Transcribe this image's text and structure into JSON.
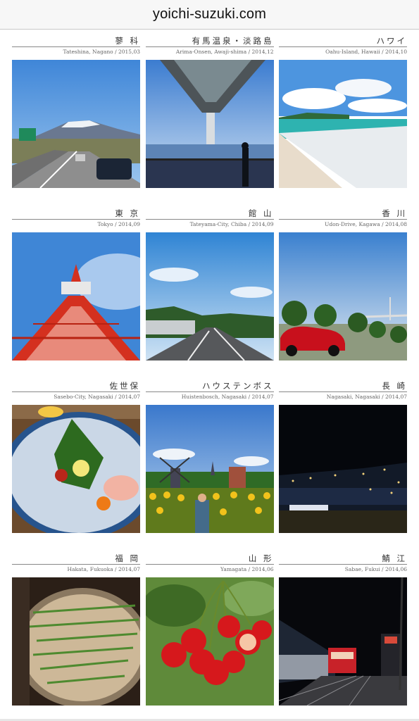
{
  "site": {
    "title": "yoichi-suzuki.com"
  },
  "posts": [
    {
      "title": "蓼 科",
      "subtitle": "Tateshina, Nagano / 2015,03",
      "photo": "highway-mountain-photo"
    },
    {
      "title": "有馬温泉・淡路島",
      "subtitle": "Arima-Onsen, Awaji-shima / 2014,12",
      "photo": "bridge-underside-photo"
    },
    {
      "title": "ハワイ",
      "subtitle": "Oahu-Island, Hawaii / 2014,10",
      "photo": "beach-photo"
    },
    {
      "title": "東 京",
      "subtitle": "Tokyo / 2014,09",
      "photo": "tokyo-tower-photo"
    },
    {
      "title": "館 山",
      "subtitle": "Tateyama-City, Chiba / 2014,09",
      "photo": "road-photo"
    },
    {
      "title": "香 川",
      "subtitle": "Udon-Drive, Kagawa / 2014,08",
      "photo": "red-car-photo"
    },
    {
      "title": "佐世保",
      "subtitle": "Sasebo-City, Nagasaki / 2014,07",
      "photo": "fugu-sashimi-photo"
    },
    {
      "title": "ハウステンボス",
      "subtitle": "Huistenbosch, Nagasaki / 2014,07",
      "photo": "windmill-sunflower-photo"
    },
    {
      "title": "長 崎",
      "subtitle": "Nagasaki, Nagasaki / 2014,07",
      "photo": "night-view-photo"
    },
    {
      "title": "福 岡",
      "subtitle": "Hakata, Fukuoka / 2014,07",
      "photo": "motsunabe-photo"
    },
    {
      "title": "山 形",
      "subtitle": "Yamagata / 2014,06",
      "photo": "cherries-photo"
    },
    {
      "title": "鯖 江",
      "subtitle": "Sabae, Fukui / 2014,06",
      "photo": "station-night-photo"
    }
  ]
}
